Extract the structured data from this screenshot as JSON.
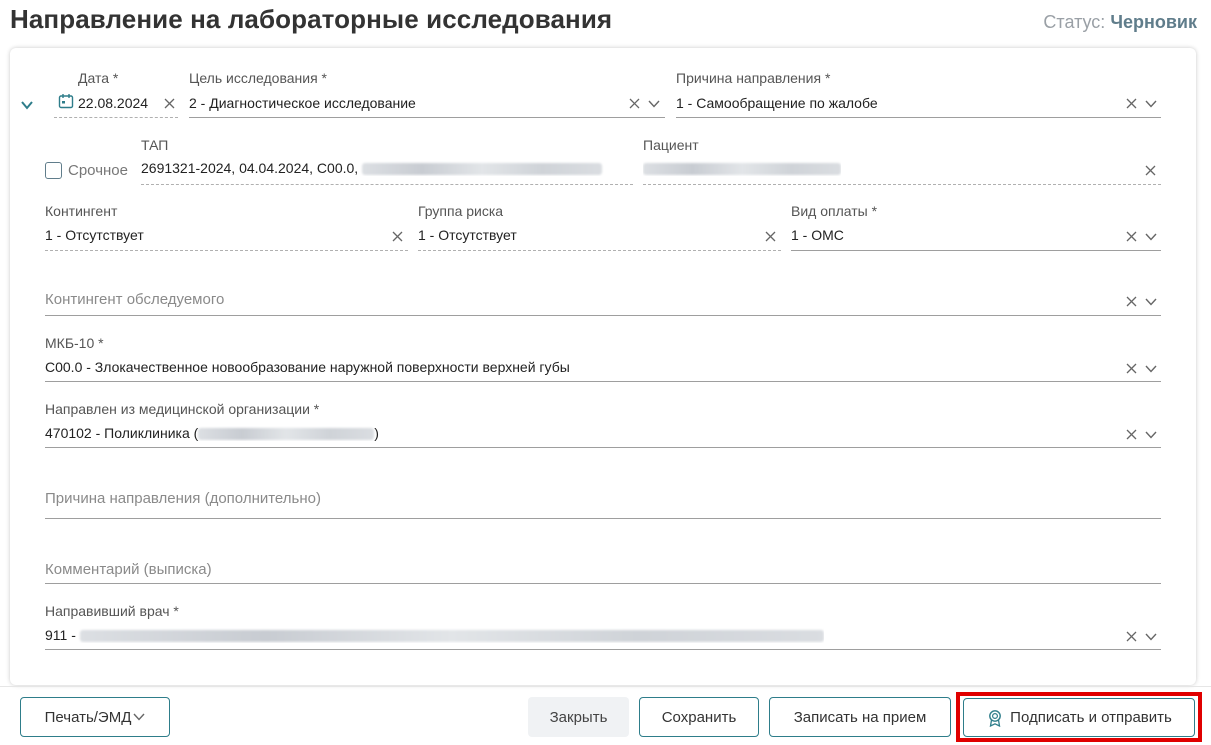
{
  "header": {
    "title": "Направление на лабораторные исследования",
    "status_label": "Статус:",
    "status_value": "Черновик"
  },
  "form": {
    "date": {
      "label": "Дата *",
      "value": "22.08.2024"
    },
    "purpose": {
      "label": "Цель исследования *",
      "value": "2 - Диагностическое исследование"
    },
    "reason": {
      "label": "Причина направления *",
      "value": "1 - Самообращение по жалобе"
    },
    "urgent": {
      "label": "Срочное",
      "checked": false
    },
    "tap": {
      "label": "ТАП",
      "value": "2691321-2024, 04.04.2024, C00.0,"
    },
    "patient": {
      "label": "Пациент"
    },
    "contingent": {
      "label": "Контингент",
      "value": "1 - Отсутствует"
    },
    "risk_group": {
      "label": "Группа риска",
      "value": "1 - Отсутствует"
    },
    "payment": {
      "label": "Вид оплаты *",
      "value": "1 - ОМС"
    },
    "examined_contingent": {
      "placeholder": "Контингент обследуемого"
    },
    "mkb": {
      "label": "МКБ-10 *",
      "value": "C00.0 - Злокачественное новообразование наружной поверхности верхней губы"
    },
    "org": {
      "label": "Направлен из медицинской организации *",
      "value_prefix": "470102 - Поликлиника (",
      "value_suffix": ")"
    },
    "reason_extra": {
      "placeholder": "Причина направления (дополнительно)"
    },
    "comment": {
      "placeholder": "Комментарий (выписка)"
    },
    "doctor": {
      "label": "Направивший врач *",
      "value_prefix": "911 -"
    }
  },
  "footer": {
    "print_label": "Печать/ЭМД",
    "close_label": "Закрыть",
    "save_label": "Сохранить",
    "appointment_label": "Записать на прием",
    "sign_label": "Подписать и отправить"
  },
  "colors": {
    "accent": "#2e7d8a",
    "highlight": "#e00000",
    "status": "#607d8b"
  }
}
